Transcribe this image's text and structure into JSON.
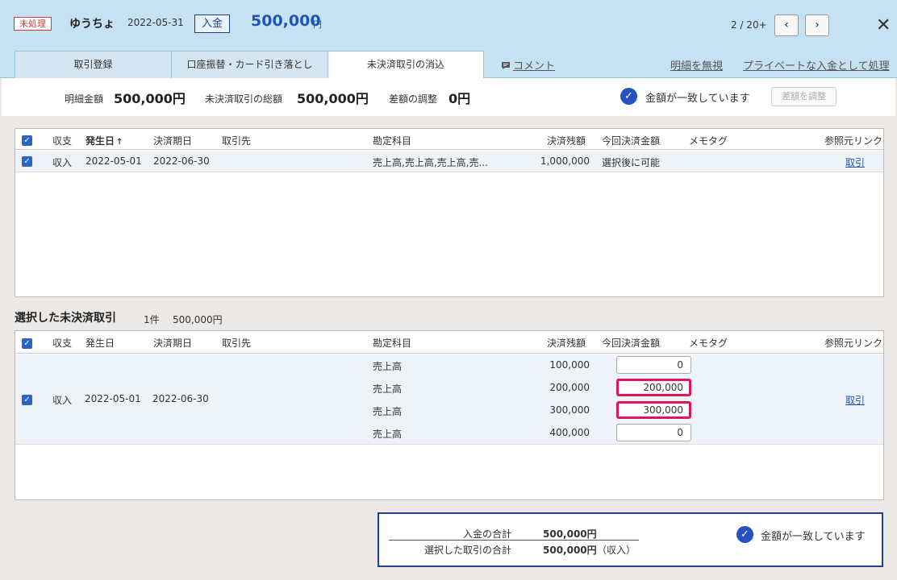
{
  "header": {
    "status_badge": "未処理",
    "payee": "ゆうちょ",
    "date": "2022-05-31",
    "type_badge": "入金",
    "amount": "500,000",
    "amount_unit": "円",
    "pager": "2 / 20+",
    "prev_icon": "‹",
    "next_icon": "›",
    "close_icon": "✕"
  },
  "tabs": [
    {
      "label": "取引登録"
    },
    {
      "label": "口座振替・カード引き落とし"
    },
    {
      "label": "未決済取引の消込"
    }
  ],
  "header_links": {
    "comment": "コメント",
    "ignore": "明細を無視",
    "private": "プライベートな入金として処理"
  },
  "summary": {
    "statement_label": "明細金額",
    "statement_value": "500,000円",
    "total_label": "未決済取引の総額",
    "total_value": "500,000円",
    "diff_label": "差額の調整",
    "diff_value": "0円",
    "match_text": "金額が一致しています",
    "adjust_button": "差額を調整"
  },
  "columns": {
    "type": "収支",
    "date": "発生日",
    "sort_icon": "↑",
    "due": "決済期日",
    "partner": "取引先",
    "account": "勘定科目",
    "balance": "決済残額",
    "pay": "今回決済金額",
    "memo": "メモタグ",
    "ref": "参照元リンク"
  },
  "unsettled": {
    "rows": [
      {
        "type": "収入",
        "date": "2022-05-01",
        "due": "2022-06-30",
        "account": "売上高,売上高,売上高,売...",
        "balance": "1,000,000",
        "pay": "選択後に可能",
        "ref": "取引"
      }
    ]
  },
  "selected": {
    "title": "選択した未決済取引",
    "count": "1件",
    "amount": "500,000円",
    "row": {
      "type": "収入",
      "date": "2022-05-01",
      "due": "2022-06-30",
      "ref": "取引",
      "lines": [
        {
          "account": "売上高",
          "balance": "100,000",
          "pay": "0",
          "highlight": false
        },
        {
          "account": "売上高",
          "balance": "200,000",
          "pay": "200,000",
          "highlight": true
        },
        {
          "account": "売上高",
          "balance": "300,000",
          "pay": "300,000",
          "highlight": true
        },
        {
          "account": "売上高",
          "balance": "400,000",
          "pay": "0",
          "highlight": false
        }
      ]
    }
  },
  "totals": {
    "deposit_label": "入金の合計",
    "deposit_value": "500,000円",
    "selected_label": "選択した取引の合計",
    "selected_value": "500,000円",
    "selected_note": "（収入）",
    "match_text": "金額が一致しています"
  },
  "colors": {
    "header_bg": "#c6e1f2",
    "accent_blue": "#2452c2",
    "highlight_pink": "#e0155a",
    "unprocessed_red": "#d83a3a"
  }
}
